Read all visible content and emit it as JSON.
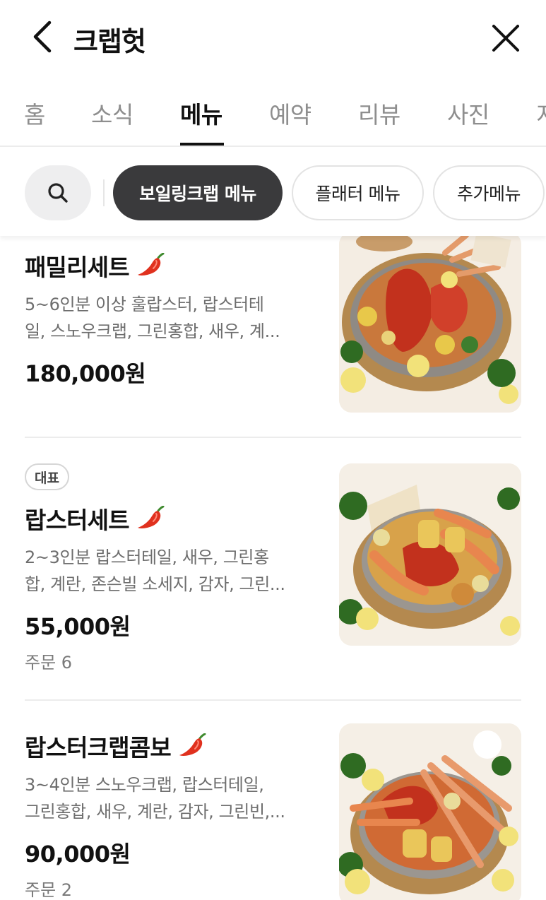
{
  "header": {
    "title": "크랩헛"
  },
  "tabs": [
    {
      "label": "홈"
    },
    {
      "label": "소식"
    },
    {
      "label": "메뉴"
    },
    {
      "label": "예약"
    },
    {
      "label": "리뷰"
    },
    {
      "label": "사진"
    },
    {
      "label": "지"
    }
  ],
  "active_tab": "메뉴",
  "chips": [
    {
      "label": "보일링크랩 메뉴"
    },
    {
      "label": "플래터 메뉴"
    },
    {
      "label": "추가메뉴"
    }
  ],
  "active_chip": "보일링크랩 메뉴",
  "colors": {
    "active_chip_bg": "#3a3a3c",
    "pepper_red": "#e0311e",
    "muted_text": "#6e6e6e"
  },
  "menu": {
    "items": [
      {
        "name": "패밀리세트",
        "spicy_icon": "chili-pepper-icon",
        "desc_line1": "5~6인분 이상 훌랍스터, 랍스터테",
        "desc_line2": "일, 스노우크랩, 그린홍합, 새우, 계...",
        "price": "180,000원"
      },
      {
        "badge": "대표",
        "name": "랍스터세트",
        "spicy_icon": "chili-pepper-icon",
        "desc_line1": "2~3인분 랍스터테일, 새우, 그린홍",
        "desc_line2": "합, 계란, 존슨빌 소세지, 감자, 그린...",
        "price": "55,000원",
        "orders": "주문 6"
      },
      {
        "name": "랍스터크랩콤보",
        "spicy_icon": "chili-pepper-icon",
        "desc_line1": "3~4인분 스노우크랩, 랍스터테일,",
        "desc_line2": "그린홍합, 새우, 계란, 감자, 그린빈,...",
        "price": "90,000원",
        "orders": "주문 2"
      }
    ]
  }
}
